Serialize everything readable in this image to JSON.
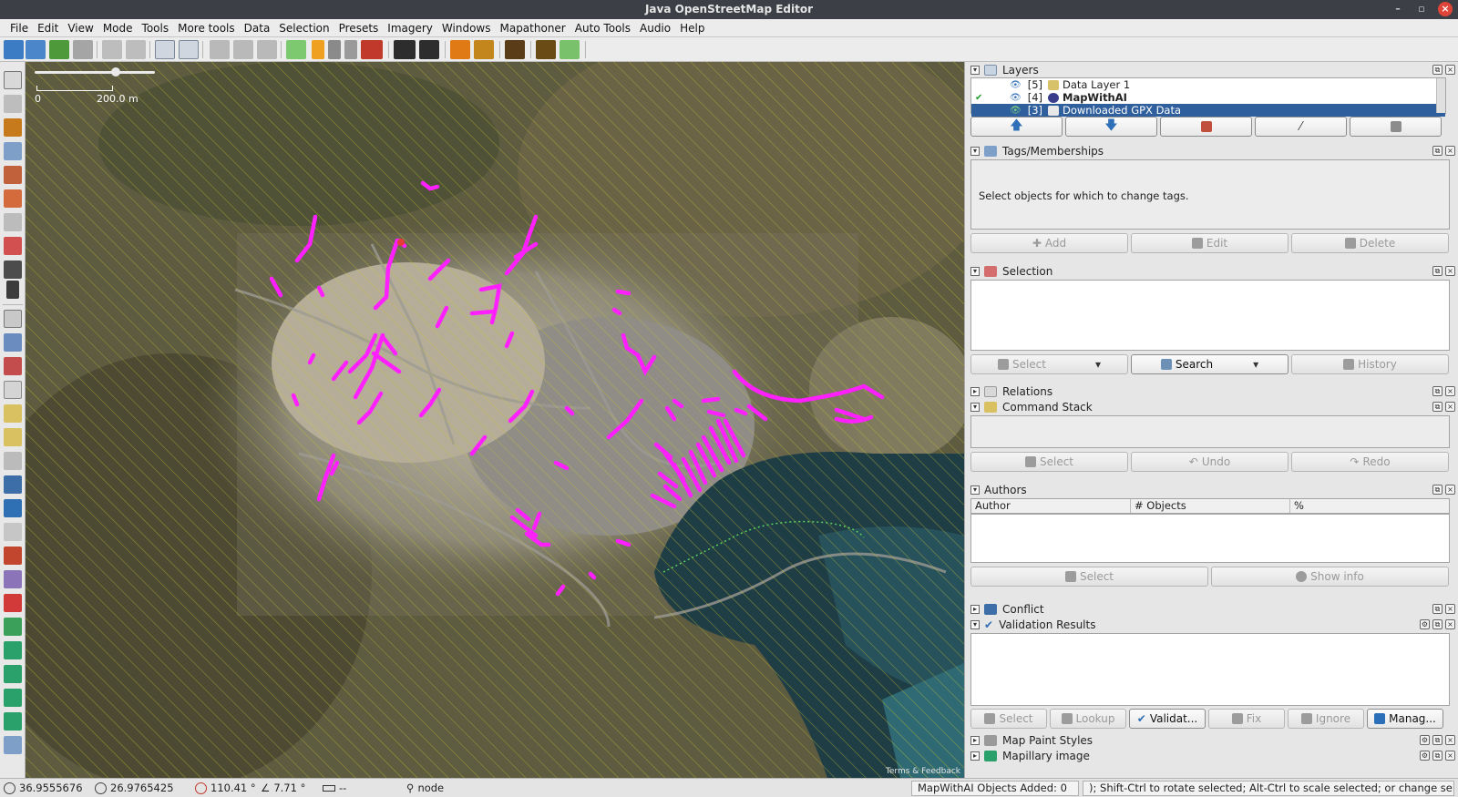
{
  "window": {
    "title": "Java OpenStreetMap Editor",
    "controls": [
      "–",
      "▫",
      "×"
    ]
  },
  "menu": [
    "File",
    "Edit",
    "View",
    "Mode",
    "Tools",
    "More tools",
    "Data",
    "Selection",
    "Presets",
    "Imagery",
    "Windows",
    "Mapathoner",
    "Auto Tools",
    "Audio",
    "Help"
  ],
  "map": {
    "scale_zero": "0",
    "scale_label": "200.0 m",
    "terms": "Terms & Feedback",
    "accent": "#ff00ff"
  },
  "layers": {
    "title": "Layers",
    "rows": [
      {
        "num": "[5]",
        "name": "Data Layer 1",
        "active": false,
        "selected": false
      },
      {
        "num": "[4]",
        "name": "MapWithAI",
        "active": true,
        "selected": false
      },
      {
        "num": "[3]",
        "name": "Downloaded GPX Data",
        "active": false,
        "selected": true
      }
    ],
    "buttons": [
      "move-up-icon",
      "move-down-icon",
      "merge-icon",
      "opacity-icon",
      "delete-icon"
    ]
  },
  "tags": {
    "title": "Tags/Memberships",
    "message": "Select objects for which to change tags.",
    "buttons": [
      "Add",
      "Edit",
      "Delete"
    ]
  },
  "selection": {
    "title": "Selection",
    "buttons": [
      "Select",
      "Search",
      "History"
    ]
  },
  "relations": {
    "title": "Relations"
  },
  "command_stack": {
    "title": "Command Stack",
    "buttons": [
      "Select",
      "Undo",
      "Redo"
    ]
  },
  "authors": {
    "title": "Authors",
    "columns": [
      "Author",
      "# Objects",
      "%"
    ],
    "buttons": [
      "Select",
      "Show info"
    ]
  },
  "conflict": {
    "title": "Conflict"
  },
  "validation": {
    "title": "Validation Results",
    "buttons": [
      "Select",
      "Lookup",
      "Validat...",
      "Fix",
      "Ignore",
      "Manag..."
    ]
  },
  "map_paint": {
    "title": "Map Paint Styles"
  },
  "mapillary": {
    "title": "Mapillary image"
  },
  "status": {
    "lat": "36.9555676",
    "lon": "26.9765425",
    "heading": "110.41 °",
    "angle": "7.71 °",
    "distance": "--",
    "member": "node",
    "mapwithai": "MapWithAI Objects Added: 0",
    "hint": "); Shift-Ctrl to rotate selected; Alt-Ctrl to scale selected; or change selection"
  }
}
